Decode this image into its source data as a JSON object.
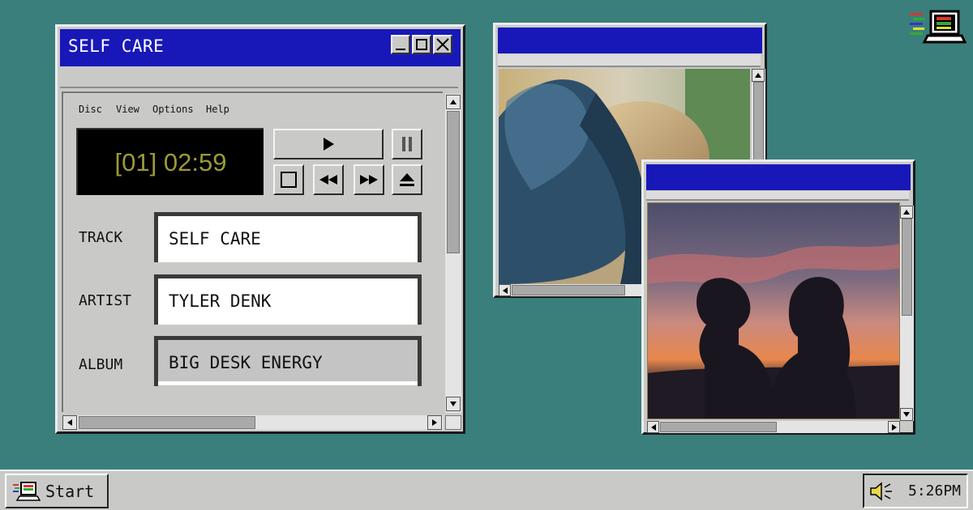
{
  "player": {
    "title": "SELF CARE",
    "menu": [
      "Disc",
      "View",
      "Options",
      "Help"
    ],
    "display": "[01] 02:59",
    "fields": {
      "track_label": "TRACK",
      "track_value": "SELF CARE",
      "artist_label": "ARTIST",
      "artist_value": "TYLER DENK",
      "album_label": "ALBUM",
      "album_value": "BIG DESK ENERGY"
    }
  },
  "windows": {
    "photo1_icon": "photo-blue-jacket-blonde-hair",
    "photo2_icon": "photo-two-silhouettes-sunset"
  },
  "taskbar": {
    "start_label": "Start",
    "clock": "5:26PM"
  },
  "colors": {
    "desktop": "#3a7f7c",
    "titlebar": "#1818b8",
    "lcd_text": "#9c9a3a",
    "chrome": "#c9cac8"
  }
}
